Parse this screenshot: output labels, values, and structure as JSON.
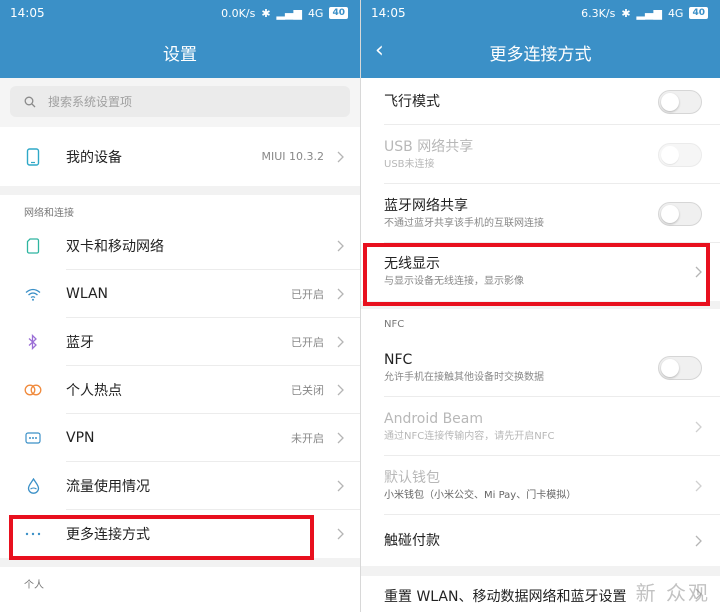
{
  "left": {
    "status": {
      "time": "14:05",
      "speed": "0.0K/s",
      "network": "4G",
      "battery": "40"
    },
    "title": "设置",
    "search_placeholder": "搜索系统设置项",
    "my_device": {
      "label": "我的设备",
      "value": "MIUI 10.3.2"
    },
    "section_network": "网络和连接",
    "items": [
      {
        "label": "双卡和移动网络",
        "value": ""
      },
      {
        "label": "WLAN",
        "value": "已开启"
      },
      {
        "label": "蓝牙",
        "value": "已开启"
      },
      {
        "label": "个人热点",
        "value": "已关闭"
      },
      {
        "label": "VPN",
        "value": "未开启"
      },
      {
        "label": "流量使用情况",
        "value": ""
      },
      {
        "label": "更多连接方式",
        "value": ""
      }
    ],
    "section_personal": "个人"
  },
  "right": {
    "status": {
      "time": "14:05",
      "speed": "6.3K/s",
      "network": "4G",
      "battery": "40"
    },
    "title": "更多连接方式",
    "rows": [
      {
        "title": "飞行模式",
        "subtitle": ""
      },
      {
        "title": "USB 网络共享",
        "subtitle": "USB未连接"
      },
      {
        "title": "蓝牙网络共享",
        "subtitle": "不通过蓝牙共享该手机的互联网连接"
      },
      {
        "title": "无线显示",
        "subtitle": "与显示设备无线连接，显示影像"
      }
    ],
    "section_nfc": "NFC",
    "nfc_rows": [
      {
        "title": "NFC",
        "subtitle": "允许手机在接触其他设备时交换数据"
      },
      {
        "title": "Android Beam",
        "subtitle": "通过NFC连接传输内容，请先开启NFC"
      },
      {
        "title": "默认钱包",
        "subtitle": "小米钱包（小米公交、Mi Pay、门卡模拟）"
      },
      {
        "title": "触碰付款",
        "subtitle": ""
      }
    ],
    "reset": "重置 WLAN、移动数据网络和蓝牙设置"
  },
  "watermark": "新 众观",
  "colors": {
    "header": "#3b90c7",
    "highlight": "#e8101e"
  }
}
